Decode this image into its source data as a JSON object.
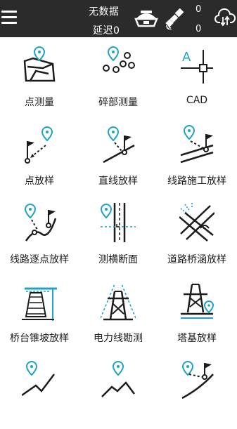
{
  "status": {
    "data_label": "无数据",
    "delay_label": "延迟0",
    "count_top": "0",
    "count_bottom": "0"
  },
  "icons": {
    "menu": "hamburger-icon",
    "gnss": "gnss-receiver-icon",
    "satellite": "satellite-icon",
    "cloud": "cloud-sync-icon"
  },
  "colors": {
    "topbar": "#2b2b2b",
    "accent": "#1fa3c6",
    "ink": "#1c1c1c"
  },
  "grid": {
    "items": [
      {
        "label": "点测量"
      },
      {
        "label": "碎部测量"
      },
      {
        "label": "CAD"
      },
      {
        "label": "点放样"
      },
      {
        "label": "直线放样"
      },
      {
        "label": "线路施工放样"
      },
      {
        "label": "线路逐点放样"
      },
      {
        "label": "测横断面"
      },
      {
        "label": "道路桥涵放样"
      },
      {
        "label": "桥台锥坡放样"
      },
      {
        "label": "电力线勘测"
      },
      {
        "label": "塔基放样"
      },
      {
        "label": ""
      },
      {
        "label": ""
      },
      {
        "label": ""
      }
    ]
  }
}
